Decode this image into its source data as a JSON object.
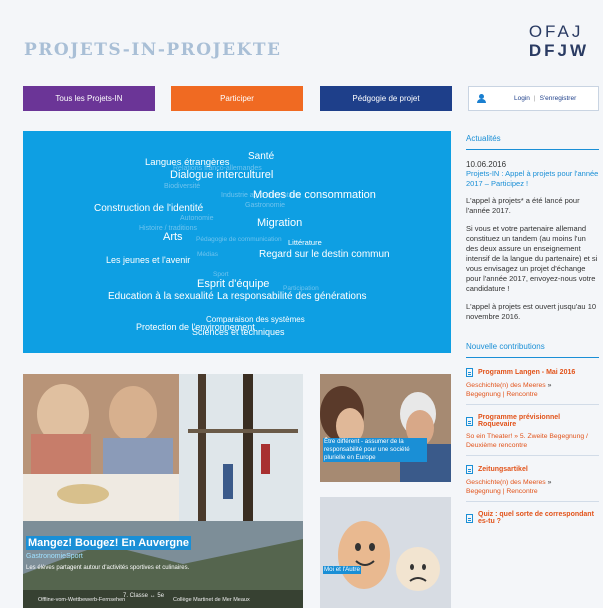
{
  "header": {
    "logo_left": "PROJETS-IN-PROJEKTE",
    "logo_right_top": "OFAJ",
    "logo_right_bottom": "DFJW"
  },
  "nav": {
    "item1": "Tous les Projets-IN",
    "item2": "Participer",
    "item3": "Pédgogie de projet",
    "login": "Login",
    "register": "S'enregistrer"
  },
  "colors": {
    "purple": "#6b3597",
    "orange": "#f06a22",
    "navy": "#1e3f8a",
    "cloud_blue": "#0e9fe3",
    "link_blue": "#1a8fd6",
    "contrib_orange": "#e2531a"
  },
  "cloud": {
    "t1": "Santé",
    "t2": "Langues étrangères",
    "t3": "Relations franco-allemandes",
    "t4": "Dialogue interculturel",
    "t5": "Biodiversité",
    "t6": "Modes de consommation",
    "t7": "Industrie agro-alimentaire",
    "t8": "Construction de l'identité",
    "t9": "Médias",
    "t10": "Gastronomie",
    "t11": "Migration",
    "t12": "Histoire / traditions",
    "t13": "Arts",
    "t14": "Littérature",
    "t15": "Regard sur le destin commun",
    "t16": "Les jeunes et l'avenir",
    "t17": "Sport",
    "t18": "Esprit d'équipe",
    "t19": "Education à la sexualité",
    "t20": "La responsabilité des générations",
    "t21": "Comparaison des systèmes",
    "t22": "Protection de l'environnement",
    "t23": "Sciences et techniques",
    "t24": "Pédagogie de communication",
    "t25": "Autonomie",
    "t26": "Participation"
  },
  "sidebar": {
    "news_heading": "Actualités",
    "news_date": "10.06.2016",
    "news_title": "Projets-IN : Appel à projets pour l'année 2017 – Participez !",
    "news_p1": "L'appel à projets* a été lancé pour l'année 2017.",
    "news_p2": "Si vous et votre partenaire allemand constituez un tandem (au moins l'un des deux assure un enseignement intensif de la langue du partenaire) et si vous envisagez un projet d'échange pour l'année 2017, envoyez-nous votre candidature !",
    "news_p3": "L'appel à projets est ouvert jusqu'au 10 novembre 2016.",
    "contrib_heading": "Nouvelle contributions",
    "c1_title": "Programm Langen - Mai 2016",
    "c1_a": "Geschichte(n) des Meeres",
    "c1_arrow": "»",
    "c1_b": "Begegnung | Rencontre",
    "c2_title": "Programme prévisionnel Roquevaire",
    "c2_a": "So ein Theater! » 5. Zweite Begegnung / Deuxième rencontre",
    "c3_title": "Zeitungsartikel",
    "c3_a": "Geschichte(n) des Meeres",
    "c3_arrow": "»",
    "c3_b": "Begegnung | Rencontre",
    "c4_title": "Quiz : quel sorte de correspondant es-tu ?"
  },
  "features": {
    "main_title": "Mangez! Bougez! En Auvergne",
    "main_category": "GastronomieSport",
    "main_text": "Les élèves partagent autour d'activités sportives et culinaires.",
    "main_bar_left": "Offline-vom-Wettbewerb-Fernsehen",
    "main_bar_nav": "7. Classe",
    "main_bar_nav2": "5e",
    "main_bar_right": "Collège Martinet de Mer Meaux",
    "card1_caption": "Être différent - assumer de la responsabilité pour une société plurielle en Europe",
    "card2_caption": "Moi et l'Autre"
  }
}
